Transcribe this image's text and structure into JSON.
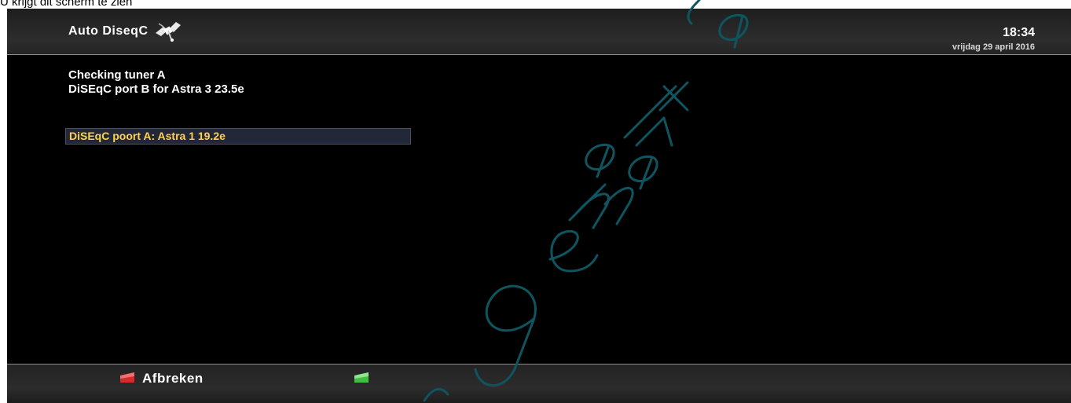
{
  "caption": "U krijgt dit scherm te zien",
  "header": {
    "title": "Auto DiseqC",
    "icon": "satellite-icon",
    "time": "18:34",
    "date": "vrijdag 29 april 2016"
  },
  "status": {
    "line1": "Checking tuner A",
    "line2": "DiSEqC port B for Astra 3 23.5e"
  },
  "list": {
    "items": [
      {
        "label": "DiSEqC poort A: Astra 1 19.2e",
        "selected": true
      }
    ]
  },
  "footer": {
    "red_label": "Afbreken",
    "green_label": ""
  },
  "colors": {
    "highlight_text": "#ffd24a",
    "red_key": "#d42a2a",
    "green_key": "#3fbf3f",
    "watermark": "#0e5560"
  }
}
